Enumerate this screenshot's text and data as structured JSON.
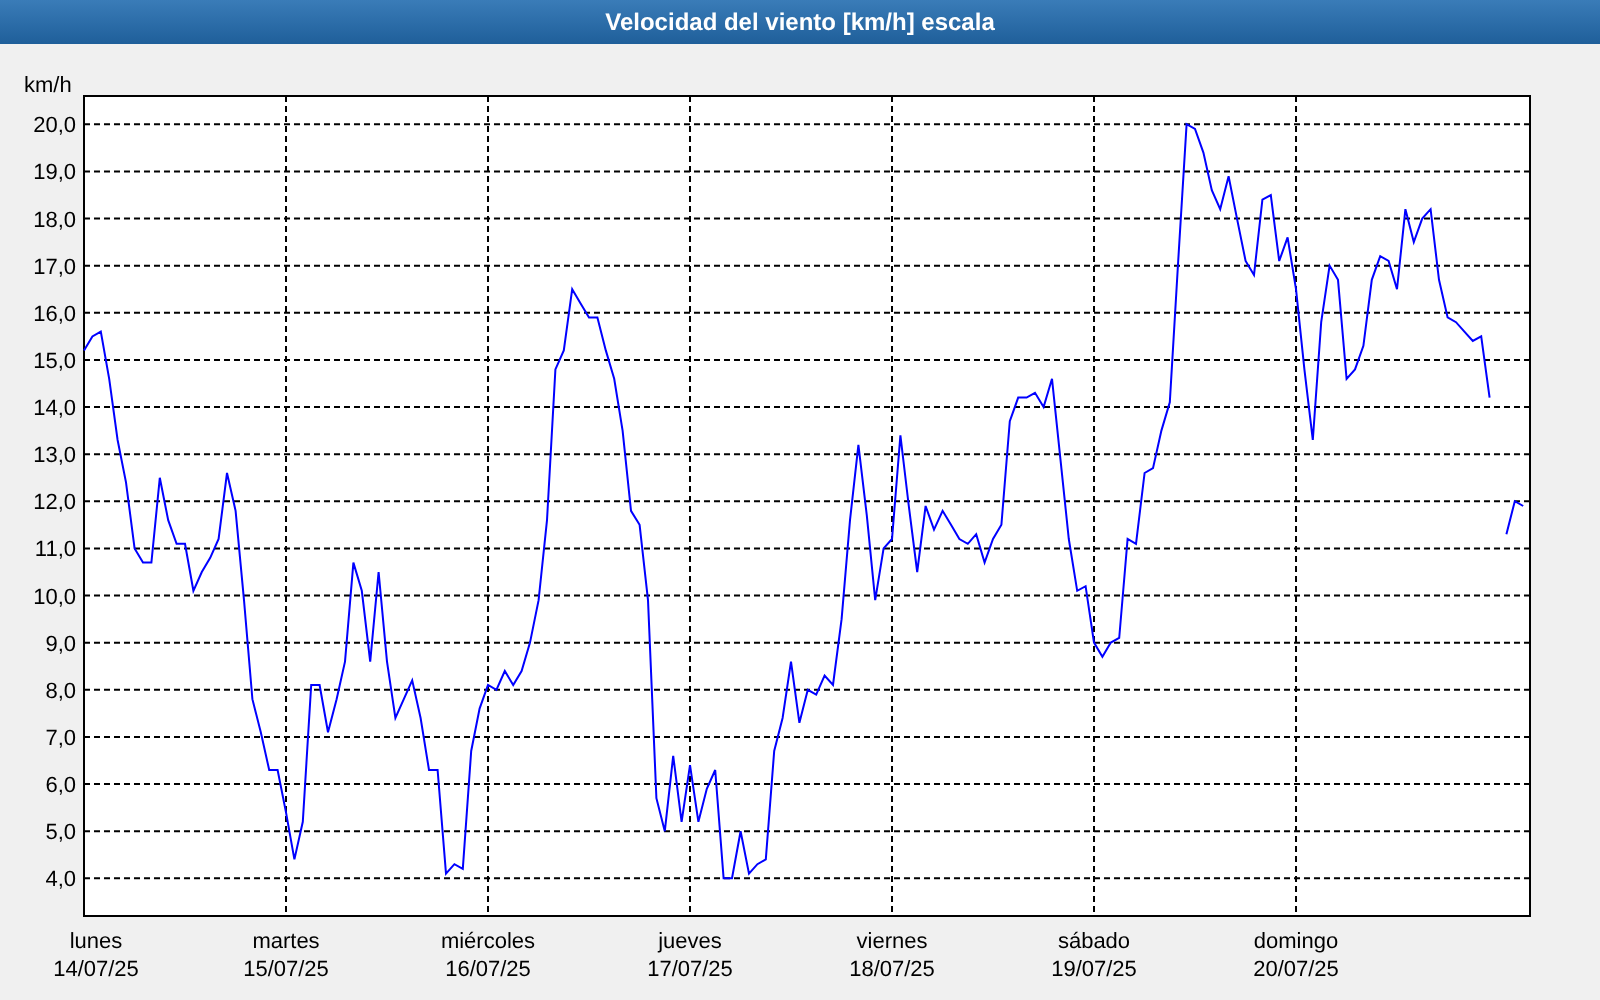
{
  "window": {
    "title": "Velocidad del viento [km/h] escala"
  },
  "chart": {
    "chart_data": {
      "type": "line",
      "ylabel": "km/h",
      "grid": true,
      "ylim": [
        3.2,
        20.6
      ],
      "categories": [
        "lunes\n14/07/25",
        null,
        null,
        null,
        null,
        null,
        null,
        null,
        null,
        null,
        null,
        null,
        null,
        null,
        null,
        null,
        null,
        null,
        null,
        null,
        null,
        null,
        null,
        null,
        "martes\n15/07/25",
        null,
        null,
        null,
        null,
        null,
        null,
        null,
        null,
        null,
        null,
        null,
        null,
        null,
        null,
        null,
        null,
        null,
        null,
        null,
        null,
        null,
        null,
        null,
        "miércoles\n16/07/25",
        null,
        null,
        null,
        null,
        null,
        null,
        null,
        null,
        null,
        null,
        null,
        null,
        null,
        null,
        null,
        null,
        null,
        null,
        null,
        null,
        null,
        null,
        null,
        "jueves\n17/07/25",
        null,
        null,
        null,
        null,
        null,
        null,
        null,
        null,
        null,
        null,
        null,
        null,
        null,
        null,
        null,
        null,
        null,
        null,
        null,
        null,
        null,
        null,
        null,
        "viernes\n18/07/25",
        null,
        null,
        null,
        null,
        null,
        null,
        null,
        null,
        null,
        null,
        null,
        null,
        null,
        null,
        null,
        null,
        null,
        null,
        null,
        null,
        null,
        null,
        null,
        "sábado\n19/07/25",
        null,
        null,
        null,
        null,
        null,
        null,
        null,
        null,
        null,
        null,
        null,
        null,
        null,
        null,
        null,
        null,
        null,
        null,
        null,
        null,
        null,
        null,
        null,
        "domingo\n20/07/25",
        null,
        null,
        null,
        null,
        null,
        null,
        null,
        null,
        null,
        null,
        null,
        null,
        null,
        null,
        null,
        null,
        null,
        null,
        null,
        null,
        null,
        null,
        null,
        null,
        null,
        null,
        null
      ],
      "yticks": [
        {
          "value": 4,
          "label": "4,0"
        },
        {
          "value": 5,
          "label": "5,0"
        },
        {
          "value": 6,
          "label": "6,0"
        },
        {
          "value": 7,
          "label": "7,0"
        },
        {
          "value": 8,
          "label": "8,0"
        },
        {
          "value": 9,
          "label": "9,0"
        },
        {
          "value": 10,
          "label": "10,0"
        },
        {
          "value": 11,
          "label": "11,0"
        },
        {
          "value": 12,
          "label": "12,0"
        },
        {
          "value": 13,
          "label": "13,0"
        },
        {
          "value": 14,
          "label": "14,0"
        },
        {
          "value": 15,
          "label": "15,0"
        },
        {
          "value": 16,
          "label": "16,0"
        },
        {
          "value": 17,
          "label": "17,0"
        },
        {
          "value": 18,
          "label": "18,0"
        },
        {
          "value": 19,
          "label": "19,0"
        },
        {
          "value": 20,
          "label": "20,0"
        }
      ],
      "series": [
        {
          "color": "#0000ff",
          "values": [
            15.2,
            15.5,
            15.6,
            14.6,
            13.3,
            12.4,
            11.0,
            10.7,
            10.7,
            12.5,
            11.6,
            11.1,
            11.1,
            10.1,
            10.5,
            10.8,
            11.2,
            12.6,
            11.8,
            9.9,
            7.8,
            7.1,
            6.3,
            6.3,
            5.4,
            4.4,
            5.2,
            8.1,
            8.1,
            7.1,
            7.8,
            8.6,
            10.7,
            10.1,
            8.6,
            10.5,
            8.6,
            7.4,
            7.8,
            8.2,
            7.4,
            6.3,
            6.3,
            4.1,
            4.3,
            4.2,
            6.7,
            7.6,
            8.1,
            8.0,
            8.4,
            8.1,
            8.4,
            9.0,
            9.9,
            11.6,
            14.8,
            15.2,
            16.5,
            16.2,
            15.9,
            15.9,
            15.2,
            14.6,
            13.5,
            11.8,
            11.5,
            9.9,
            5.7,
            5.0,
            6.6,
            5.2,
            6.4,
            5.2,
            5.9,
            6.3,
            4.0,
            4.0,
            5.0,
            4.1,
            4.3,
            4.4,
            6.7,
            7.4,
            8.6,
            7.3,
            8.0,
            7.9,
            8.3,
            8.1,
            9.5,
            11.6,
            13.2,
            11.7,
            9.9,
            11.0,
            11.2,
            13.4,
            11.9,
            10.5,
            11.9,
            11.4,
            11.8,
            11.5,
            11.2,
            11.1,
            11.3,
            10.7,
            11.2,
            11.5,
            13.7,
            14.2,
            14.2,
            14.3,
            14.0,
            14.6,
            12.9,
            11.2,
            10.1,
            10.2,
            9.0,
            8.7,
            9.0,
            9.1,
            11.2,
            11.1,
            12.6,
            12.7,
            13.5,
            14.1,
            17.1,
            20.0,
            19.9,
            19.4,
            18.6,
            18.2,
            18.9,
            18.0,
            17.1,
            16.8,
            18.4,
            18.5,
            17.1,
            17.6,
            16.5,
            14.8,
            13.3,
            15.8,
            17.0,
            16.7,
            14.6,
            14.8,
            15.3,
            16.7,
            17.2,
            17.1,
            16.5,
            18.2,
            17.5,
            18.0,
            18.2,
            16.7,
            15.9,
            15.8,
            15.6,
            15.4,
            15.5,
            14.2,
            null,
            11.3,
            12.0,
            11.9
          ]
        }
      ]
    }
  }
}
